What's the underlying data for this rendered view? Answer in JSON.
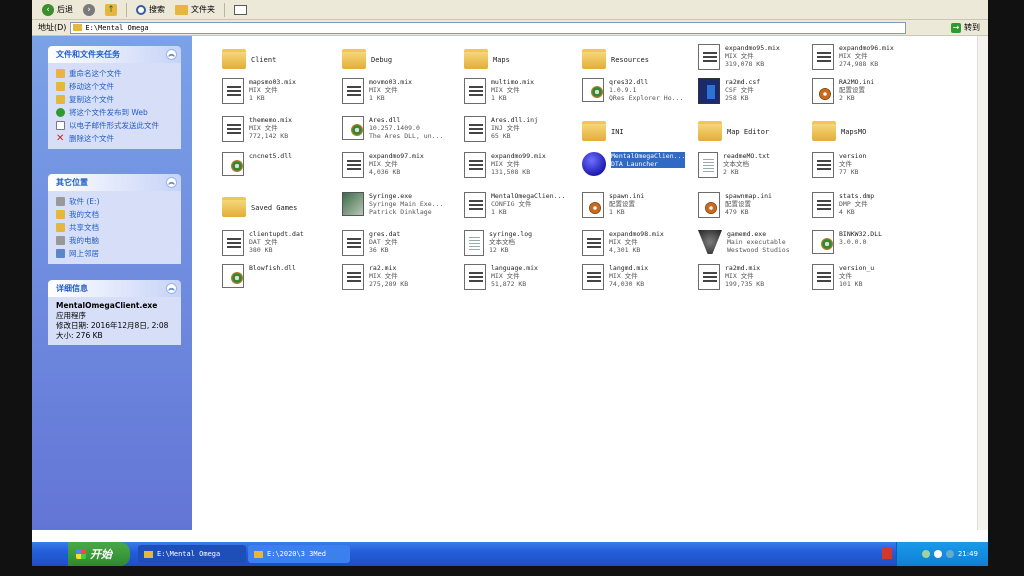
{
  "toolbar": {
    "back_label": "后退",
    "search_label": "搜索",
    "folders_label": "文件夹"
  },
  "address": {
    "label": "地址(D)",
    "path": "E:\\Mental Omega",
    "go_label": "转到"
  },
  "tasks_panel": {
    "title": "文件和文件夹任务",
    "items": [
      {
        "label": "重命名这个文件",
        "icon": "rename-icon"
      },
      {
        "label": "移动这个文件",
        "icon": "move-icon"
      },
      {
        "label": "复制这个文件",
        "icon": "copy-icon"
      },
      {
        "label": "将这个文件发布到 Web",
        "icon": "web-icon"
      },
      {
        "label": "以电子邮件形式发送此文件",
        "icon": "mail-icon"
      },
      {
        "label": "删除这个文件",
        "icon": "delete-icon"
      }
    ]
  },
  "places_panel": {
    "title": "其它位置",
    "items": [
      {
        "label": "软件 (E:)"
      },
      {
        "label": "我的文档"
      },
      {
        "label": "共享文档"
      },
      {
        "label": "我的电脑"
      },
      {
        "label": "网上邻居"
      }
    ]
  },
  "details_panel": {
    "title": "详细信息",
    "name": "MentalOmegaClient.exe",
    "type": "应用程序",
    "modified": "修改日期: 2016年12月8日, 2:08",
    "size": "大小: 276 KB"
  },
  "files": [
    {
      "name": "Client",
      "kind": "folder"
    },
    {
      "name": "Debug",
      "kind": "folder"
    },
    {
      "name": "Maps",
      "kind": "folder"
    },
    {
      "name": "Resources",
      "kind": "folder"
    },
    {
      "name": "expandmo95.mix",
      "type": "MIX 文件",
      "size": "319,078 KB",
      "kind": "mix"
    },
    {
      "name": "expandmo96.mix",
      "type": "MIX 文件",
      "size": "274,988 KB",
      "kind": "mix"
    },
    {
      "name": "mapsmo03.mix",
      "type": "MIX 文件",
      "size": "1 KB",
      "kind": "mix"
    },
    {
      "name": "movmo03.mix",
      "type": "MIX 文件",
      "size": "1 KB",
      "kind": "mix"
    },
    {
      "name": "multimo.mix",
      "type": "MIX 文件",
      "size": "1 KB",
      "kind": "mix"
    },
    {
      "name": "qres32.dll",
      "type": "1.0.9.1",
      "size": "QRes Explorer Ho...",
      "kind": "dll"
    },
    {
      "name": "ra2md.csf",
      "type": "CSF 文件",
      "size": "258 KB",
      "kind": "csf"
    },
    {
      "name": "RA2MO.ini",
      "type": "配置设置",
      "size": "2 KB",
      "kind": "ini"
    },
    {
      "name": "thememo.mix",
      "type": "MIX 文件",
      "size": "772,142 KB",
      "kind": "mix"
    },
    {
      "name": "Ares.dll",
      "type": "10.257.1409.0",
      "size": "The Ares DLL, un...",
      "kind": "dll"
    },
    {
      "name": "Ares.dll.inj",
      "type": "INJ 文件",
      "size": "65 KB",
      "kind": "mix"
    },
    {
      "name": "INI",
      "kind": "folder"
    },
    {
      "name": "Map Editor",
      "kind": "folder"
    },
    {
      "name": "MapsMO",
      "kind": "folder"
    },
    {
      "name": "cncnet5.dll",
      "kind": "dll"
    },
    {
      "name": "expandmo97.mix",
      "type": "MIX 文件",
      "size": "4,036 KB",
      "kind": "mix"
    },
    {
      "name": "expandmo99.mix",
      "type": "MIX 文件",
      "size": "131,508 KB",
      "kind": "mix"
    },
    {
      "name": "MentalOmegaClien...",
      "type": "DTA Launcher",
      "size": "",
      "kind": "orb",
      "selected": true
    },
    {
      "name": "readmeMO.txt",
      "type": "文本文档",
      "size": "2 KB",
      "kind": "txt"
    },
    {
      "name": "version",
      "type": "文件",
      "size": "77 KB",
      "kind": "mix"
    },
    {
      "name": "Saved Games",
      "kind": "folder"
    },
    {
      "name": "Syringe.exe",
      "type": "Syringe Main Exe...",
      "size": "Patrick Dinklage",
      "kind": "syringe"
    },
    {
      "name": "MentalOmegaClien...",
      "type": "CONFIG 文件",
      "size": "1 KB",
      "kind": "mix"
    },
    {
      "name": "spawn.ini",
      "type": "配置设置",
      "size": "1 KB",
      "kind": "ini"
    },
    {
      "name": "spawnmap.ini",
      "type": "配置设置",
      "size": "479 KB",
      "kind": "ini"
    },
    {
      "name": "stats.dmp",
      "type": "DMP 文件",
      "size": "4 KB",
      "kind": "mix"
    },
    {
      "name": "clientupdt.dat",
      "type": "DAT 文件",
      "size": "380 KB",
      "kind": "mix"
    },
    {
      "name": "gres.dat",
      "type": "DAT 文件",
      "size": "36 KB",
      "kind": "mix"
    },
    {
      "name": "syringe.log",
      "type": "文本文档",
      "size": "12 KB",
      "kind": "txt"
    },
    {
      "name": "expandmo98.mix",
      "type": "MIX 文件",
      "size": "4,301 KB",
      "kind": "mix"
    },
    {
      "name": "gamemd.exe",
      "type": "Main executable",
      "size": "Westwood Studios",
      "kind": "ww"
    },
    {
      "name": "BINKW32.DLL",
      "type": "3.0.0.0",
      "size": "",
      "kind": "dll"
    },
    {
      "name": "Blowfish.dll",
      "kind": "dll"
    },
    {
      "name": "ra2.mix",
      "type": "MIX 文件",
      "size": "275,289 KB",
      "kind": "mix"
    },
    {
      "name": "language.mix",
      "type": "MIX 文件",
      "size": "51,872 KB",
      "kind": "mix"
    },
    {
      "name": "langmd.mix",
      "type": "MIX 文件",
      "size": "74,030 KB",
      "kind": "mix"
    },
    {
      "name": "ra2md.mix",
      "type": "MIX 文件",
      "size": "199,735 KB",
      "kind": "mix"
    },
    {
      "name": "version_u",
      "type": "文件",
      "size": "101 KB",
      "kind": "mix"
    }
  ],
  "taskbar": {
    "start_label": "开始",
    "window1": "E:\\Mental Omega",
    "window2": "E:\\2020\\3 3Med",
    "clock": "21:49"
  }
}
